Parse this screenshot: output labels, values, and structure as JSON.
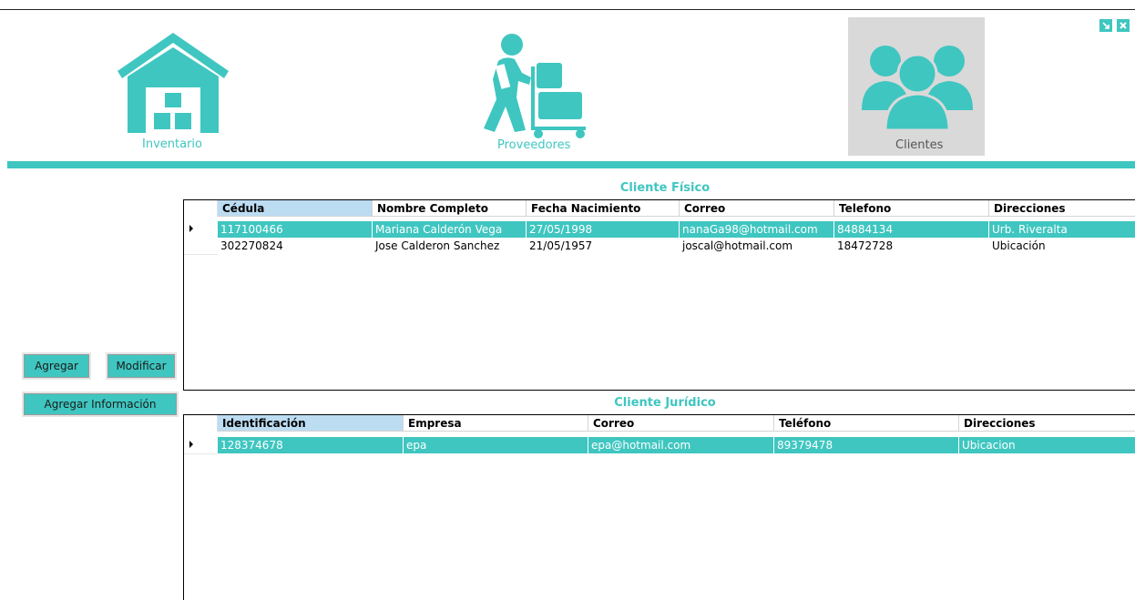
{
  "nav": {
    "items": [
      {
        "label": "Inventario",
        "icon": "warehouse-icon"
      },
      {
        "label": "Proveedores",
        "icon": "delivery-worker-icon"
      },
      {
        "label": "Clientes",
        "icon": "users-group-icon"
      }
    ],
    "selected": "Clientes"
  },
  "window_controls": {
    "restore_icon": "restore-icon",
    "close_icon": "close-icon"
  },
  "colors": {
    "accent": "#3fc6c0",
    "selected_tile": "#d9d9d9",
    "header_selected": "#bcdcf2"
  },
  "buttons": {
    "agregar": "Agregar",
    "modificar": "Modificar",
    "agregar_informacion": "Agregar Información"
  },
  "fisico": {
    "title": "Cliente Físico",
    "columns": [
      "Cédula",
      "Nombre Completo",
      "Fecha Nacimiento",
      "Correo",
      "Telefono",
      "Direcciones"
    ],
    "rows": [
      [
        "117100466",
        "Mariana Calderón Vega",
        "27/05/1998",
        "nanaGa98@hotmail.com",
        "84884134",
        "Urb. Riveralta"
      ],
      [
        "302270824",
        "Jose Calderon Sanchez",
        "21/05/1957",
        "joscal@hotmail.com",
        "18472728",
        "Ubicación"
      ]
    ],
    "selected_row": 0
  },
  "juridico": {
    "title": "Cliente Jurídico",
    "columns": [
      "Identificación",
      "Empresa",
      "Correo",
      "Teléfono",
      "Direcciones"
    ],
    "rows": [
      [
        "128374678",
        "epa",
        "epa@hotmail.com",
        "89379478",
        "Ubicacion"
      ]
    ],
    "selected_row": 0
  }
}
